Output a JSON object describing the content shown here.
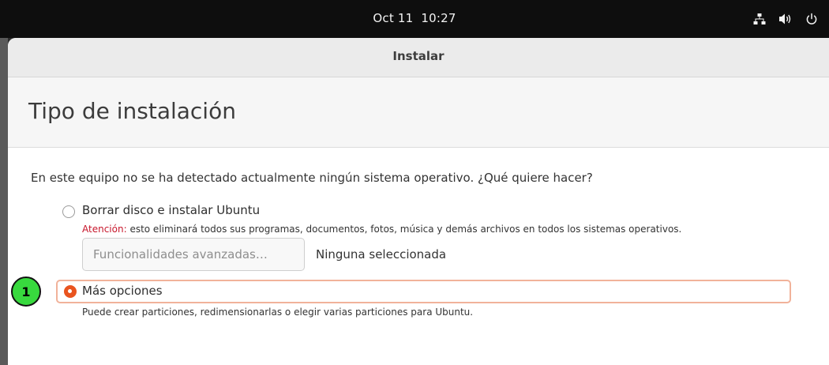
{
  "topbar": {
    "date": "Oct 11",
    "time": "10:27"
  },
  "window": {
    "title": "Instalar",
    "heading": "Tipo de instalación",
    "question": "En este equipo no se ha detectado actualmente ningún sistema operativo. ¿Qué quiere hacer?",
    "option_erase": {
      "label": "Borrar disco e instalar Ubuntu",
      "warning_prefix": "Atención:",
      "warning_text": " esto eliminará todos sus programas, documentos, fotos, música y demás archivos en todos los sistemas operativos.",
      "selected": false
    },
    "advanced_button": "Funcionalidades avanzadas…",
    "advanced_status": "Ninguna seleccionada",
    "option_more": {
      "label": "Más opciones",
      "description": "Puede crear particiones, redimensionarlas o elegir varias particiones para Ubuntu.",
      "selected": true
    }
  },
  "marker": {
    "number": "1"
  },
  "colors": {
    "accent": "#e9541f",
    "warning": "#c7162b",
    "marker": "#38d93e"
  }
}
